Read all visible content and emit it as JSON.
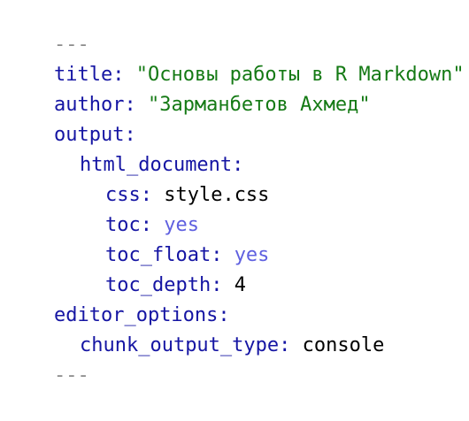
{
  "yaml": {
    "delim_open": "---",
    "title": {
      "key": "title:",
      "value": "\"Основы работы в R Markdown\""
    },
    "author": {
      "key": "author:",
      "value": "\"Зарманбетов Ахмед\""
    },
    "output": {
      "key": "output:"
    },
    "html_document": {
      "key": "html_document:"
    },
    "css": {
      "key": "css:",
      "value": "style.css"
    },
    "toc": {
      "key": "toc:",
      "value": "yes"
    },
    "toc_float": {
      "key": "toc_float:",
      "value": "yes"
    },
    "toc_depth": {
      "key": "toc_depth:",
      "value": "4"
    },
    "editor_options": {
      "key": "editor_options:"
    },
    "chunk_output_type": {
      "key": "chunk_output_type:",
      "value": "console"
    },
    "delim_close": "---"
  },
  "colors": {
    "key": "#1515a3",
    "string": "#157a15",
    "boolean": "#5f60e0",
    "delimiter": "#8c8c8c",
    "plain": "#000000"
  }
}
